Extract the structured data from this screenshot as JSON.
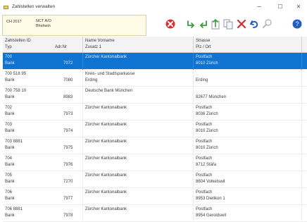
{
  "window": {
    "title": "Zahlstellen verwalten",
    "minimize_glyph": "–",
    "maximize_glyph": "☐",
    "close_glyph": "✕"
  },
  "filter": {
    "left_text": "CH 2017",
    "right_line1": "NCT A/O",
    "right_line2": "Bhshwin"
  },
  "toolbar": {
    "icons": [
      "cancel-icon",
      "arrow-right-icon",
      "arrow-left-icon",
      "document-up-icon",
      "copy-icon",
      "delete-icon",
      "undo-icon",
      "search-icon",
      "help-icon"
    ],
    "colors": {
      "cancel": "#d93030",
      "arrow": "#3a9a3a",
      "delete": "#d22b2b",
      "undo": "#1f5fbf",
      "help": "#1f5fbf"
    }
  },
  "columns": {
    "zahlstelle_id": "Zahlstellen ID",
    "typ": "Typ",
    "adr_nr": "Adr.Nr",
    "name": "Name Vorname",
    "zusatz": "Zusatz 1",
    "strasse": "Strasse",
    "plz_ort": "Plz / Ort"
  },
  "rows": [
    {
      "id": "700",
      "typ": "Bank",
      "adr": "7072",
      "name": "Zürcher Kantonalbank",
      "zusatz": "",
      "strasse": "Postfach",
      "ort": "8010 Zürich",
      "selected": true
    },
    {
      "id": "700 518 95",
      "typ": "Bank",
      "adr": "7080",
      "name": "Kreis- und Stadtsparkasse",
      "zusatz": "Erding",
      "strasse": "",
      "ort": "Erding",
      "selected": false
    },
    {
      "id": "700 758 10",
      "typ": "Bank",
      "adr": "8983",
      "name": "Deutsche Bank München",
      "zusatz": "",
      "strasse": "",
      "ort": "82677 München",
      "selected": false
    },
    {
      "id": "702",
      "typ": "Bank",
      "adr": "7973",
      "name": "Zürcher Kantonalbank",
      "zusatz": "",
      "strasse": "Postfach",
      "ort": "8036 Zürich",
      "selected": false
    },
    {
      "id": "703",
      "typ": "Bank",
      "adr": "7974",
      "name": "Zürcher Kantonalbank",
      "zusatz": "",
      "strasse": "Postfach",
      "ort": "8010 Zürich",
      "selected": false
    },
    {
      "id": "703 8881",
      "typ": "Bank",
      "adr": "7975",
      "name": "Zürcher Kantonalbank",
      "zusatz": "",
      "strasse": "Postfach",
      "ort": "8010 Zürich",
      "selected": false
    },
    {
      "id": "704",
      "typ": "Bank",
      "adr": "7976",
      "name": "Zürcher Kantonalbank",
      "zusatz": "",
      "strasse": "Postfach",
      "ort": "8712 Stäfa",
      "selected": false
    },
    {
      "id": "705",
      "typ": "Bank",
      "adr": "7270",
      "name": "Zürcher Kantonalbank",
      "zusatz": "",
      "strasse": "Postfach",
      "ort": "8604 Volketswil",
      "selected": false
    },
    {
      "id": "706",
      "typ": "Bank",
      "adr": "7977",
      "name": "Zürcher Kantonalbank",
      "zusatz": "",
      "strasse": "Postfach",
      "ort": "8953 Dietikon 1",
      "selected": false
    },
    {
      "id": "706 8881",
      "typ": "Bank",
      "adr": "7978",
      "name": "Zürcher Kantonalbank",
      "zusatz": "",
      "strasse": "Postfach",
      "ort": "8954 Geroldswil",
      "selected": false
    }
  ]
}
